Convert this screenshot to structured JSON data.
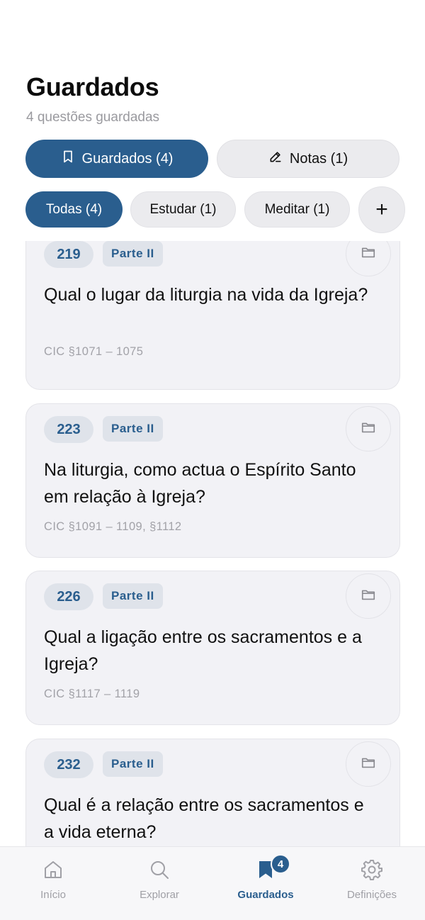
{
  "header": {
    "title": "Guardados",
    "subtitle": "4 questões guardadas"
  },
  "segments": {
    "saved": {
      "label": "Guardados (4)",
      "icon": "bookmark-icon",
      "active": true
    },
    "notes": {
      "label": "Notas (1)",
      "icon": "pencil-icon",
      "active": false
    }
  },
  "filters": {
    "items": [
      {
        "label": "Todas (4)",
        "active": true
      },
      {
        "label": "Estudar (1)",
        "active": false
      },
      {
        "label": "Meditar (1)",
        "active": false
      }
    ],
    "add_label": "+"
  },
  "cards": [
    {
      "number": "219",
      "part": "Parte II",
      "question": "Qual o lugar da liturgia na vida da Igreja?",
      "reference": "CIC §1071 – 1075"
    },
    {
      "number": "223",
      "part": "Parte II",
      "question": "Na liturgia, como actua o Espírito Santo em relação à Igreja?",
      "reference": "CIC §1091 – 1109, §1112"
    },
    {
      "number": "226",
      "part": "Parte II",
      "question": "Qual a ligação entre os sacramentos e a Igreja?",
      "reference": "CIC §1117 – 1119"
    },
    {
      "number": "232",
      "part": "Parte II",
      "question": "Qual é a relação entre os sacramentos e a vida eterna?",
      "reference": ""
    }
  ],
  "tabbar": {
    "items": [
      {
        "label": "Início",
        "icon": "home-icon",
        "active": false
      },
      {
        "label": "Explorar",
        "icon": "search-icon",
        "active": false
      },
      {
        "label": "Guardados",
        "icon": "bookmark-icon",
        "active": true,
        "badge": "4"
      },
      {
        "label": "Definições",
        "icon": "gear-icon",
        "active": false
      }
    ]
  },
  "colors": {
    "accent": "#2a5e8e",
    "chip_bg": "#ebebee",
    "card_bg": "#f2f2f6",
    "muted_text": "#9a9a9f"
  }
}
